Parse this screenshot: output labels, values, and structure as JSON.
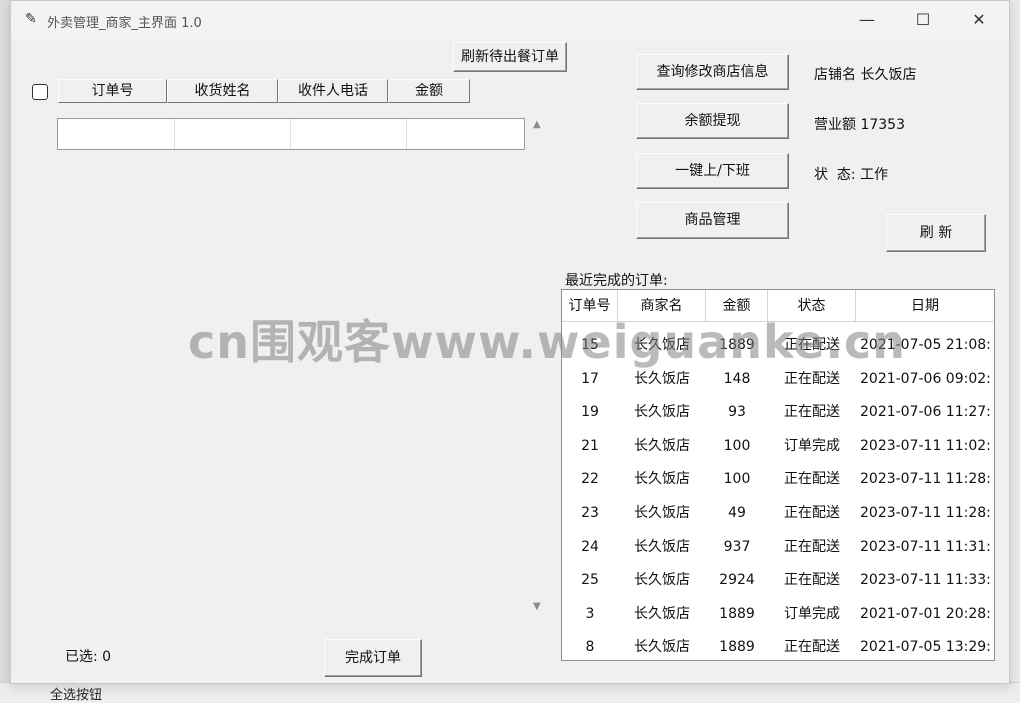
{
  "window": {
    "title": "外卖管理_商家_主界面 1.0",
    "controls": {
      "minimize": "—",
      "maximize": "☐",
      "close": "✕"
    }
  },
  "left_panel": {
    "refresh_pending_button": "刷新待出餐订单",
    "columns": [
      "订单号",
      "收货姓名",
      "收件人电话",
      "金额"
    ],
    "selected_label": "已选: 0",
    "complete_button": "完成订单"
  },
  "actions": {
    "edit_store_info": "查询修改商店信息",
    "withdraw": "余额提现",
    "toggle_shift": "一键上/下班",
    "goods_manage": "商品管理",
    "refresh": "刷 新"
  },
  "store": {
    "name_label": "店铺名 长久饭店",
    "revenue_label": "营业额 17353",
    "status_label": "状  态: 工作"
  },
  "recent_orders": {
    "title": "最近完成的订单:",
    "columns": [
      "订单号",
      "商家名",
      "金额",
      "状态",
      "日期"
    ],
    "rows": [
      [
        "15",
        "长久饭店",
        "1889",
        "正在配送",
        "2021-07-05 21:08:"
      ],
      [
        "17",
        "长久饭店",
        "148",
        "正在配送",
        "2021-07-06 09:02:"
      ],
      [
        "19",
        "长久饭店",
        "93",
        "正在配送",
        "2021-07-06 11:27:"
      ],
      [
        "21",
        "长久饭店",
        "100",
        "订单完成",
        "2023-07-11 11:02:"
      ],
      [
        "22",
        "长久饭店",
        "100",
        "正在配送",
        "2023-07-11 11:28:"
      ],
      [
        "23",
        "长久饭店",
        "49",
        "正在配送",
        "2023-07-11 11:28:"
      ],
      [
        "24",
        "长久饭店",
        "937",
        "正在配送",
        "2023-07-11 11:31:"
      ],
      [
        "25",
        "长久饭店",
        "2924",
        "正在配送",
        "2023-07-11 11:33:"
      ],
      [
        "3",
        "长久饭店",
        "1889",
        "订单完成",
        "2021-07-01 20:28:"
      ],
      [
        "8",
        "长久饭店",
        "1889",
        "正在配送",
        "2021-07-05 13:29:"
      ]
    ]
  },
  "watermark": "cn围观客www.weiguanke.cn",
  "background": {
    "bottom_text": "全选按钮"
  }
}
